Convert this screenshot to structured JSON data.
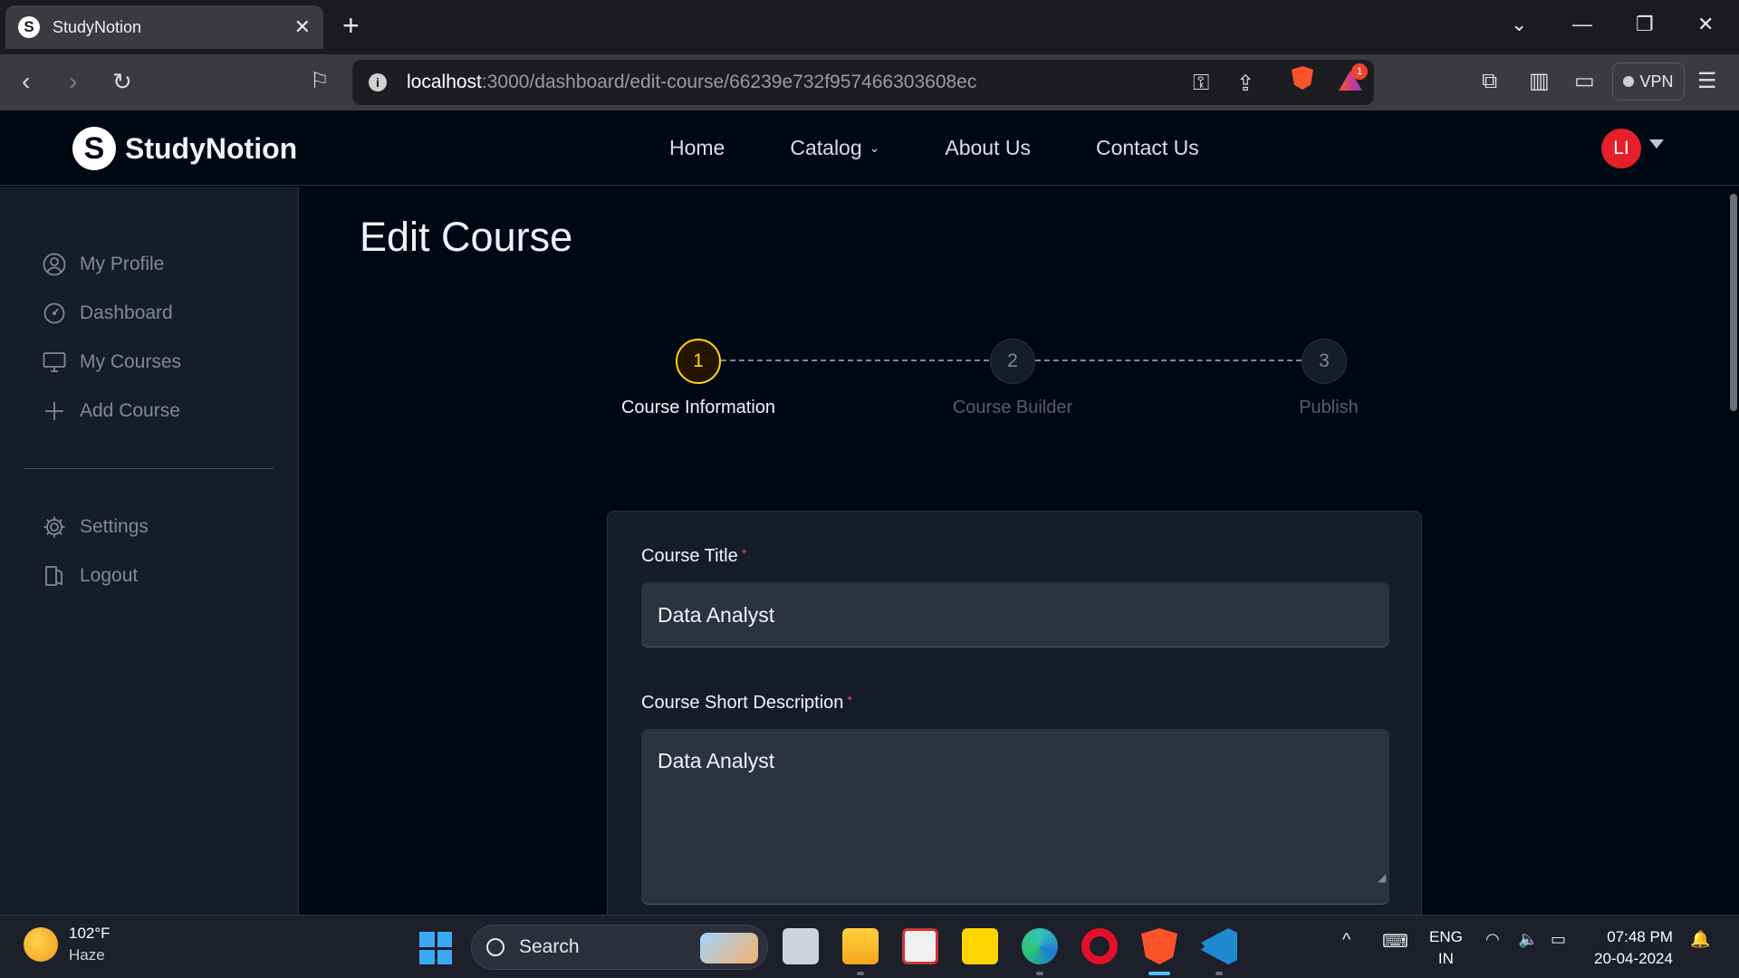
{
  "browser": {
    "tab_title": "StudyNotion",
    "tab_favicon": "S",
    "url_host": "localhost",
    "url_rest": ":3000/dashboard/edit-course/66239e732f957466303608ec",
    "notification_count": "1",
    "vpn_label": "VPN"
  },
  "navbar": {
    "logo_mark": "S",
    "logo_text": "StudyNotion",
    "links": [
      "Home",
      "Catalog",
      "About Us",
      "Contact Us"
    ],
    "avatar_initials": "LI"
  },
  "sidebar": {
    "items": [
      {
        "label": "My Profile",
        "icon": "profile-icon"
      },
      {
        "label": "Dashboard",
        "icon": "dashboard-icon"
      },
      {
        "label": "My Courses",
        "icon": "monitor-icon"
      },
      {
        "label": "Add Course",
        "icon": "plus-icon"
      }
    ],
    "bottom_items": [
      {
        "label": "Settings",
        "icon": "settings-icon"
      },
      {
        "label": "Logout",
        "icon": "logout-icon"
      }
    ]
  },
  "main": {
    "title": "Edit Course",
    "steps": [
      {
        "number": "1",
        "label": "Course Information",
        "active": true
      },
      {
        "number": "2",
        "label": "Course Builder",
        "active": false
      },
      {
        "number": "3",
        "label": "Publish",
        "active": false
      }
    ],
    "form": {
      "course_title_label": "Course Title",
      "course_title_value": "Data Analyst",
      "short_desc_label": "Course Short Description",
      "short_desc_value": "Data Analyst",
      "required_mark": "*"
    }
  },
  "taskbar": {
    "weather_temp": "102°F",
    "weather_desc": "Haze",
    "search_label": "Search",
    "lang_top": "ENG",
    "lang_bottom": "IN",
    "time": "07:48 PM",
    "date": "20-04-2024"
  },
  "colors": {
    "accent_yellow": "#ffd60a",
    "page_bg": "#000814",
    "sidebar_bg": "#161d29",
    "required_red": "#ef476f",
    "avatar_red": "#e5202a"
  }
}
